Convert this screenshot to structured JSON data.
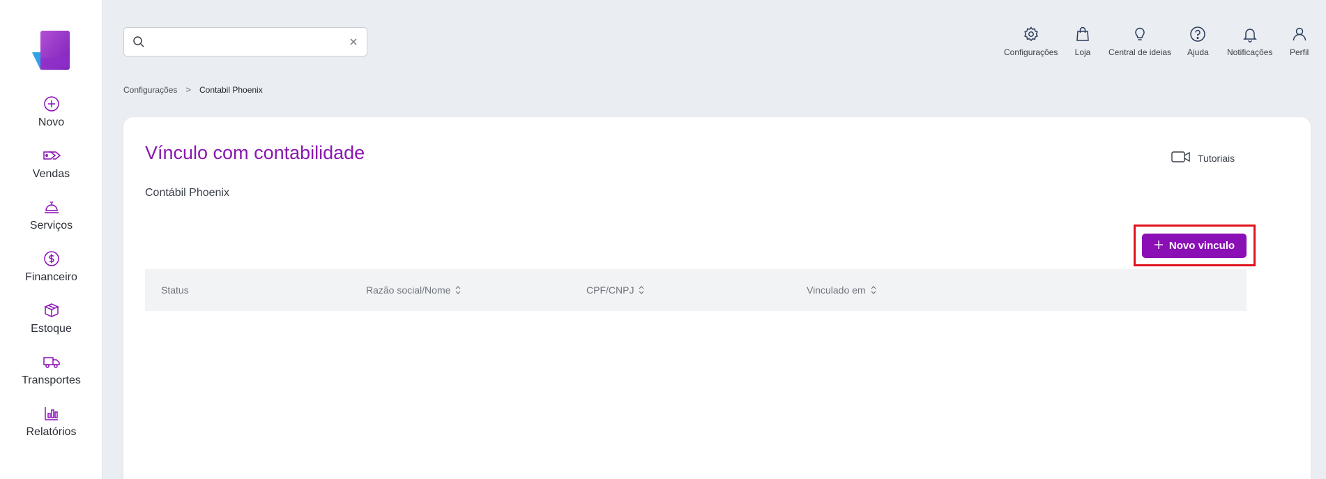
{
  "sidebar": {
    "items": [
      {
        "label": "Novo",
        "icon": "plus-circle-icon"
      },
      {
        "label": "Vendas",
        "icon": "tags-icon"
      },
      {
        "label": "Serviços",
        "icon": "service-bell-icon"
      },
      {
        "label": "Financeiro",
        "icon": "dollar-circle-icon"
      },
      {
        "label": "Estoque",
        "icon": "box-icon"
      },
      {
        "label": "Transportes",
        "icon": "truck-icon"
      },
      {
        "label": "Relatórios",
        "icon": "bar-chart-icon"
      }
    ]
  },
  "search": {
    "value": "",
    "placeholder": ""
  },
  "top_actions": [
    {
      "label": "Configurações",
      "icon": "gear-icon"
    },
    {
      "label": "Loja",
      "icon": "shopping-bag-icon"
    },
    {
      "label": "Central de ideias",
      "icon": "lightbulb-icon"
    },
    {
      "label": "Ajuda",
      "icon": "help-circle-icon"
    },
    {
      "label": "Notificações",
      "icon": "bell-icon"
    },
    {
      "label": "Perfil",
      "icon": "user-icon"
    }
  ],
  "breadcrumb": {
    "parent": "Configurações",
    "separator": ">",
    "current": "Contabil Phoenix"
  },
  "page": {
    "title": "Vínculo com contabilidade",
    "subtitle": "Contábil Phoenix",
    "tutorials_label": "Tutoriais",
    "new_button_label": "Novo vinculo"
  },
  "table": {
    "columns": [
      {
        "label": "Status",
        "sortable": false
      },
      {
        "label": "Razão social/Nome",
        "sortable": true
      },
      {
        "label": "CPF/CNPJ",
        "sortable": true
      },
      {
        "label": "Vinculado em",
        "sortable": true
      }
    ],
    "rows": []
  },
  "colors": {
    "accent": "#8a0fb5",
    "title": "#8a18b0",
    "highlight": "#e0121b"
  }
}
